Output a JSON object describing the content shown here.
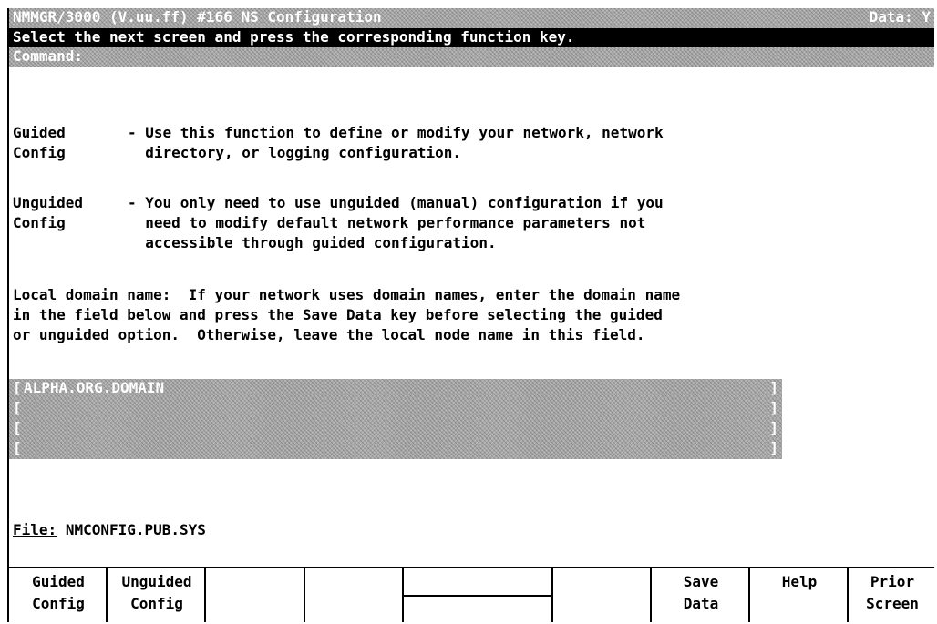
{
  "header": {
    "title": "NMMGR/3000 (V.uu.ff) #166  NS Configuration",
    "data_flag": "Data: Y"
  },
  "instruction": "Select the next screen and press the corresponding function key.",
  "command": {
    "label": "Command:",
    "value": ""
  },
  "body": {
    "guided": {
      "term_1": "Guided",
      "term_2": "Config",
      "desc_1": "- Use this function to define or modify your network, network",
      "desc_2": "  directory, or logging configuration."
    },
    "unguided": {
      "term_1": "Unguided",
      "term_2": "Config",
      "desc_1": "- You only need to use unguided (manual) configuration if you",
      "desc_2": "  need to modify default network performance parameters not",
      "desc_3": "  accessible through guided configuration."
    },
    "local_domain": {
      "line_1": "Local domain name:  If your network uses domain names, enter the domain name",
      "line_2": "in the field below and press the Save Data key before selecting the guided",
      "line_3": "or unguided option.  Otherwise, leave the local node name in this field."
    }
  },
  "domain_fields": [
    {
      "open": "[",
      "value": "ALPHA.ORG.DOMAIN",
      "close": "]"
    },
    {
      "open": "[",
      "value": "",
      "close": "]"
    },
    {
      "open": "[",
      "value": "",
      "close": "]"
    },
    {
      "open": "[",
      "value": "",
      "close": "]"
    }
  ],
  "file": {
    "label": "File:",
    "value": "NMCONFIG.PUB.SYS"
  },
  "function_keys": [
    {
      "line1": "Guided",
      "line2": "Config"
    },
    {
      "line1": "Unguided",
      "line2": "Config"
    },
    {
      "line1": "",
      "line2": ""
    },
    {
      "line1": "",
      "line2": ""
    },
    {
      "line1": "",
      "line2": ""
    },
    {
      "line1": "",
      "line2": ""
    },
    {
      "line1": "Save",
      "line2": "Data"
    },
    {
      "line1": "Help",
      "line2": ""
    },
    {
      "line1": "Prior",
      "line2": "Screen"
    }
  ]
}
